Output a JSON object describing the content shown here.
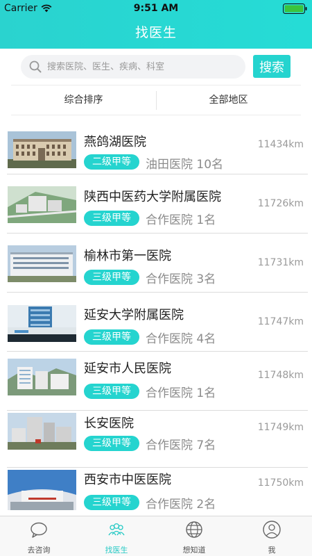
{
  "status_bar": {
    "carrier": "Carrier",
    "time": "9:51 AM"
  },
  "nav": {
    "title": "找医生"
  },
  "search": {
    "placeholder": "搜索医院、医生、疾病、科室",
    "value": "",
    "button_label": "搜索"
  },
  "filters": {
    "sort": "综合排序",
    "region": "全部地区"
  },
  "colors": {
    "accent": "#25d4cf",
    "header": "#27d8d3"
  },
  "hospitals": [
    {
      "name": "燕鸽湖医院",
      "level": "二级甲等",
      "coop": "油田医院 10名",
      "distance": "11434km"
    },
    {
      "name": "陕西中医药大学附属医院",
      "level": "三级甲等",
      "coop": "合作医院 1名",
      "distance": "11726km"
    },
    {
      "name": "榆林市第一医院",
      "level": "三级甲等",
      "coop": "合作医院 3名",
      "distance": "11731km"
    },
    {
      "name": "延安大学附属医院",
      "level": "三级甲等",
      "coop": "合作医院 4名",
      "distance": "11747km"
    },
    {
      "name": "延安市人民医院",
      "level": "三级甲等",
      "coop": "合作医院 1名",
      "distance": "11748km"
    },
    {
      "name": "长安医院",
      "level": "三级甲等",
      "coop": "合作医院 7名",
      "distance": "11749km"
    },
    {
      "name": "西安市中医医院",
      "level": "三级甲等",
      "coop": "合作医院 2名",
      "distance": "11750km"
    }
  ],
  "tabs": [
    {
      "label": "去咨询",
      "icon": "chat-bubble-icon"
    },
    {
      "label": "找医生",
      "icon": "doctors-icon",
      "active": true
    },
    {
      "label": "想知道",
      "icon": "globe-icon"
    },
    {
      "label": "我",
      "icon": "user-icon"
    }
  ]
}
